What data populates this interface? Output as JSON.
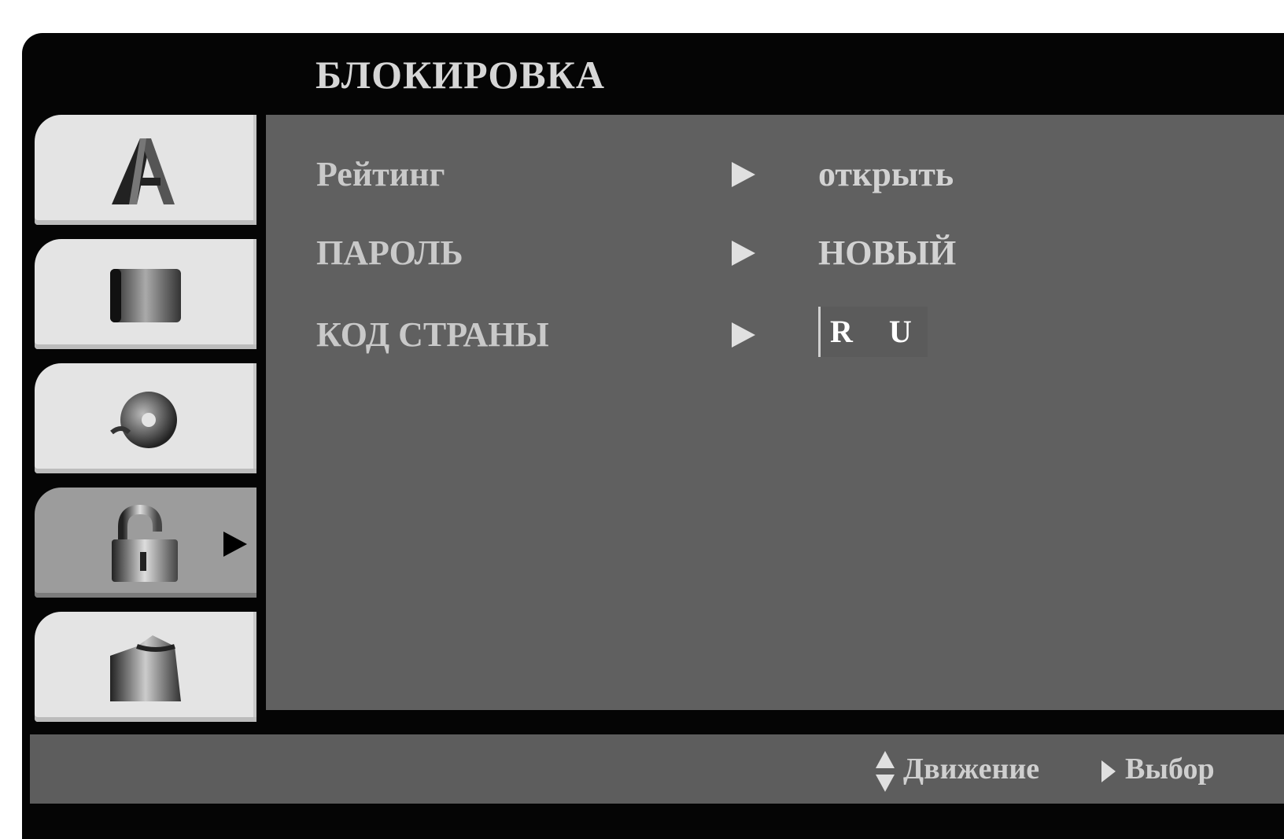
{
  "menu": {
    "title": "БЛОКИРОВКА"
  },
  "sidebar": {
    "tabs": [
      {
        "icon": "language-icon",
        "active": false
      },
      {
        "icon": "display-icon",
        "active": false
      },
      {
        "icon": "audio-icon",
        "active": false
      },
      {
        "icon": "lock-icon",
        "active": true
      },
      {
        "icon": "other-settings-icon",
        "active": false
      }
    ]
  },
  "settings": {
    "rows": [
      {
        "label": "Рейтинг",
        "value": "открыть"
      },
      {
        "label": "ПАРОЛЬ",
        "value": "НОВЫЙ"
      },
      {
        "label": "КОД СТРАНЫ",
        "value": "R U"
      }
    ]
  },
  "footer": {
    "move_hint": "Движение",
    "select_hint": "Выбор"
  },
  "colors": {
    "frame": "#050505",
    "panel": "#606060",
    "tab": "#e4e4e4",
    "active_tab": "#9c9c9c",
    "text": "#c9c9c9"
  }
}
